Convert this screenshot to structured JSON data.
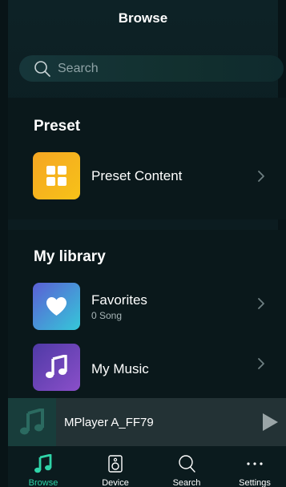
{
  "header": {
    "title": "Browse"
  },
  "search": {
    "placeholder": "Search"
  },
  "preset": {
    "title": "Preset",
    "items": [
      {
        "label": "Preset Content",
        "icon": "grid-icon",
        "color_from": "#f5a623",
        "color_to": "#f7c218"
      }
    ]
  },
  "library": {
    "title": "My library",
    "items": [
      {
        "label": "Favorites",
        "sublabel": "0 Song",
        "icon": "heart-icon",
        "color_from": "#5b5fd6",
        "color_to": "#35c8d8"
      },
      {
        "label": "My Music",
        "icon": "music-note-icon",
        "color_from": "#4f3aa6",
        "color_to": "#8a4fc9"
      }
    ]
  },
  "player": {
    "title": "MPlayer A_FF79"
  },
  "tabs": [
    {
      "label": "Browse",
      "icon": "music-note-icon",
      "active": true
    },
    {
      "label": "Device",
      "icon": "speaker-icon",
      "active": false
    },
    {
      "label": "Search",
      "icon": "search-icon",
      "active": false
    },
    {
      "label": "Settings",
      "icon": "more-icon",
      "active": false
    }
  ],
  "colors": {
    "accent": "#2fd4a8",
    "background": "#0b1c20",
    "player_bar": "#233235"
  }
}
